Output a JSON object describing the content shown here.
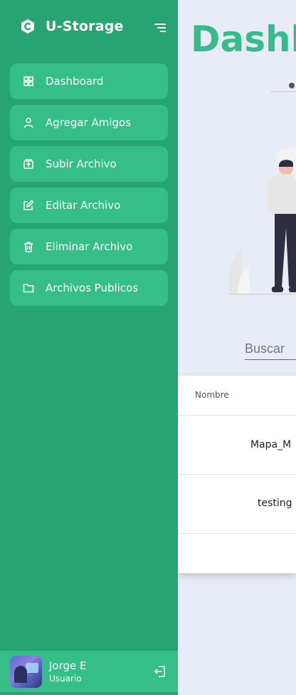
{
  "brand": {
    "name": "U-Storage"
  },
  "nav": {
    "items": [
      {
        "label": "Dashboard",
        "icon": "dashboard-grid-icon"
      },
      {
        "label": "Agregar Amigos",
        "icon": "user-icon"
      },
      {
        "label": "Subir Archivo",
        "icon": "upload-box-icon"
      },
      {
        "label": "Editar Archivo",
        "icon": "edit-icon"
      },
      {
        "label": "Eliminar Archivo",
        "icon": "trash-icon"
      },
      {
        "label": "Archivos Publicos",
        "icon": "folder-icon"
      }
    ]
  },
  "user": {
    "name": "Jorge E",
    "role": "Usuario"
  },
  "main": {
    "title": "Dashb",
    "search_placeholder": "Buscar",
    "table": {
      "columns": [
        "Nombre"
      ],
      "rows": [
        {
          "nombre": "Mapa_M"
        },
        {
          "nombre": "testing"
        }
      ]
    }
  },
  "colors": {
    "sidebar": "#28a474",
    "nav_item": "#35be88",
    "title": "#37bb8a",
    "background": "#e8ecf6"
  }
}
